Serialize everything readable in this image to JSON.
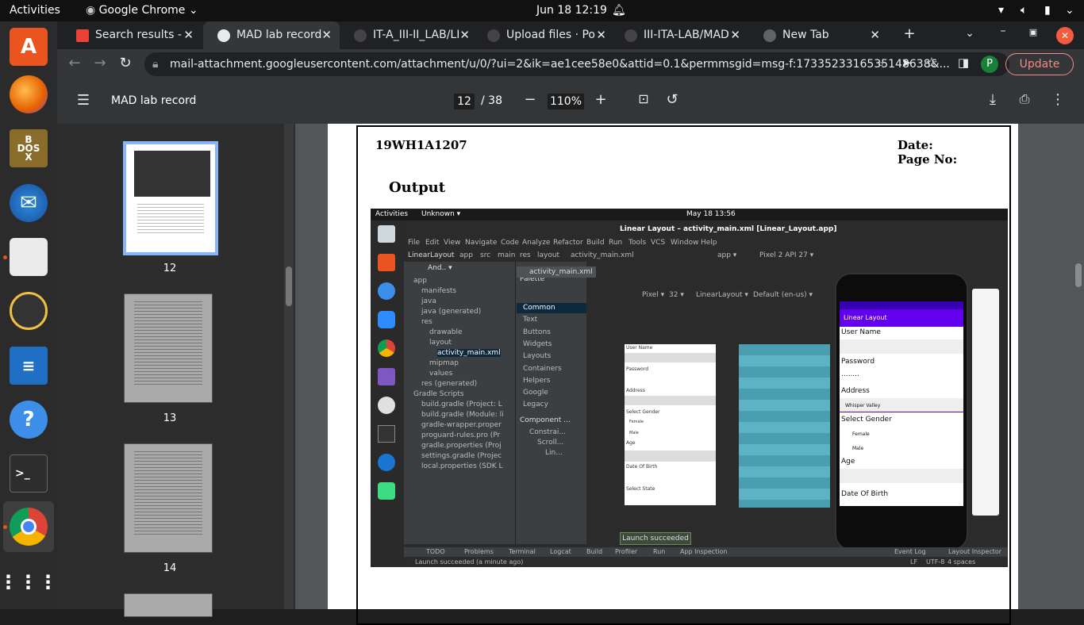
{
  "topbar": {
    "activities": "Activities",
    "app": "Google Chrome",
    "clock": "Jun 18  12:19"
  },
  "tabs": [
    {
      "label": "Search results -"
    },
    {
      "label": "MAD lab record"
    },
    {
      "label": "IT-A_III-II_LAB/LI"
    },
    {
      "label": "Upload files · Po"
    },
    {
      "label": "III-ITA-LAB/MAD"
    },
    {
      "label": "New Tab"
    }
  ],
  "omnibar": {
    "url": "mail-attachment.googleusercontent.com/attachment/u/0/?ui=2&ik=ae1cee58e0&attid=0.1&permmsgid=msg-f:1733523316535148638&...",
    "update_label": "Update",
    "profile_initial": "P"
  },
  "pdf": {
    "title": "MAD lab record",
    "page_current": "12",
    "page_total": "/ 38",
    "zoom": "110%"
  },
  "thumbnails": [
    {
      "label": "12"
    },
    {
      "label": "13"
    },
    {
      "label": "14"
    }
  ],
  "document": {
    "roll_no": "19WH1A1207",
    "date_label": "Date:",
    "page_no_label": "Page No:",
    "heading": "Output"
  },
  "inner_screenshot": {
    "activities": "Activities",
    "unknown": "Unknown ▾",
    "clock": "May 18  13:56",
    "window_title": "Linear Layout – activity_main.xml [Linear_Layout.app]",
    "menu": [
      "File",
      "Edit",
      "View",
      "Navigate",
      "Code",
      "Analyze",
      "Refactor",
      "Build",
      "Run",
      "Tools",
      "VCS",
      "Window",
      "Help"
    ],
    "breadcrumb": [
      "LinearLayout",
      "app",
      "src",
      "main",
      "res",
      "layout",
      "activity_main.xml"
    ],
    "run_config": "app ▾",
    "device": "Pixel 2 API 27 ▾",
    "editor_tab": "activity_main.xml",
    "project_tree": [
      "app",
      "manifests",
      "java",
      "java (generated)",
      "res",
      "drawable",
      "layout",
      "activity_main.xml",
      "mipmap",
      "values",
      "res (generated)",
      "Gradle Scripts",
      "build.gradle (Project: L",
      "build.gradle (Module: li",
      "gradle-wrapper.proper",
      "proguard-rules.pro (Pr",
      "gradle.properties (Proj",
      "settings.gradle (Projec",
      "local.properties (SDK L"
    ],
    "palette_title": "Palette",
    "palette": [
      "Common",
      "Text",
      "Buttons",
      "Widgets",
      "Layouts",
      "Containers",
      "Helpers",
      "Google",
      "Legacy"
    ],
    "component_tree_title": "Component ...",
    "component_tree": [
      "Constrai...",
      "Scroll...",
      "Lin..."
    ],
    "design_toolbar": [
      "Pixel ▾",
      "32 ▾",
      "LinearLayout ▾",
      "Default (en-us) ▾"
    ],
    "blueprint_labels": [
      "User Name",
      "Password",
      "Address",
      "Select Gender",
      "Female",
      "Male",
      "Age",
      "Date Of Birth",
      "Select State"
    ],
    "phone": {
      "appbar": "Linear Layout",
      "fields": [
        "User Name",
        "Password",
        "........",
        "Address",
        "Whisper Valley",
        "Select Gender",
        "Female",
        "Male",
        "Age",
        "Date Of Birth"
      ]
    },
    "bottom_tabs": [
      "TODO",
      "Problems",
      "Terminal",
      "Logcat",
      "Build",
      "Profiler",
      "Run",
      "App Inspection",
      "Event Log",
      "Layout Inspector"
    ],
    "toast": "Launch succeeded",
    "status": "Launch succeeded (a minute ago)",
    "status_right": [
      "LF",
      "UTF-8",
      "4 spaces"
    ]
  },
  "colors": {
    "chrome_dark": "#202124",
    "accent_update": "#f28b82",
    "android_purple": "#6200ee",
    "ubuntu_orange": "#e95420"
  }
}
